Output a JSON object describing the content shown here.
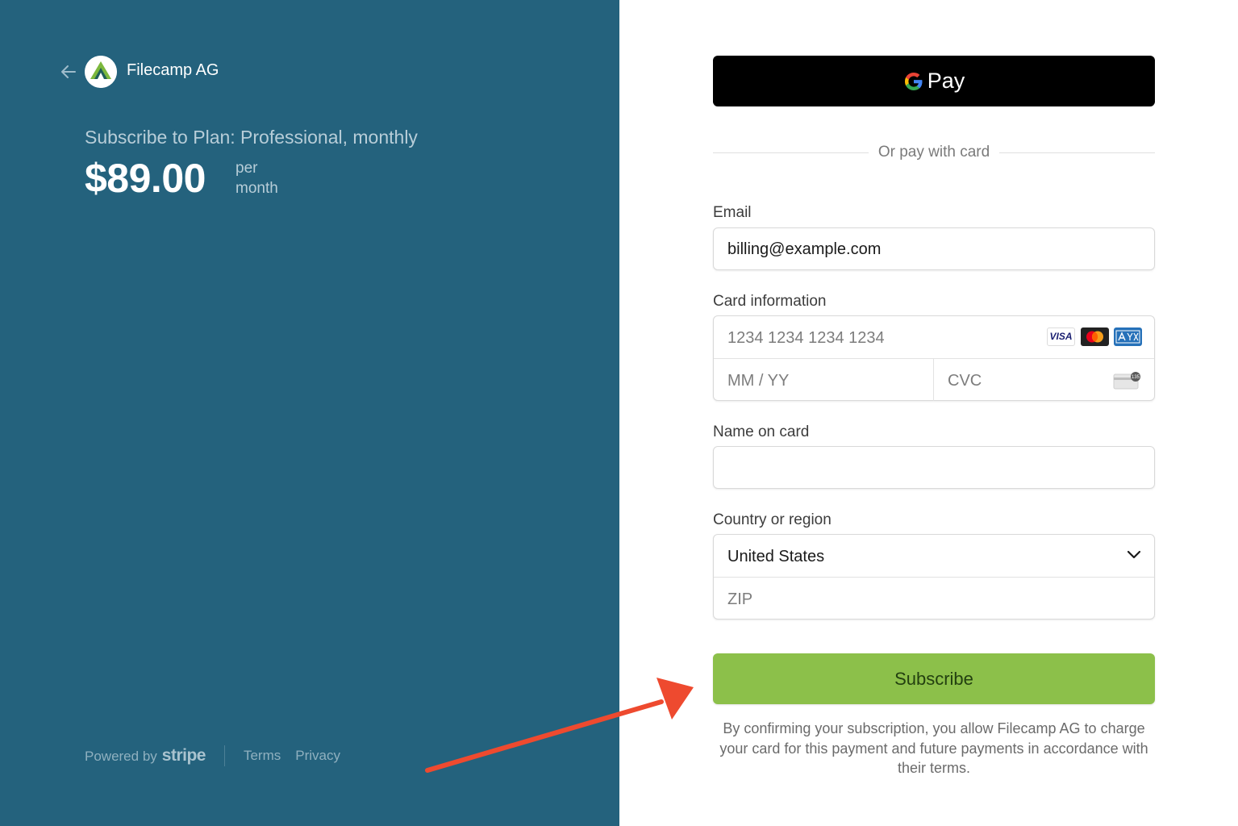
{
  "merchant": {
    "name": "Filecamp AG",
    "logo_icon": "filecamp-logo-icon"
  },
  "plan": {
    "title": "Subscribe to Plan: Professional, monthly",
    "price": "$89.00",
    "period_line1": "per",
    "period_line2": "month"
  },
  "footer": {
    "powered_by": "Powered by",
    "powered_by_brand": "stripe",
    "links": [
      "Terms",
      "Privacy"
    ]
  },
  "payment": {
    "gpay_label": "Pay",
    "or_divider": "Or pay with card",
    "email": {
      "label": "Email",
      "value": "billing@example.com"
    },
    "card": {
      "label": "Card information",
      "number_placeholder": "1234 1234 1234 1234",
      "expiry_placeholder": "MM / YY",
      "cvc_placeholder": "CVC",
      "brands": [
        "VISA",
        "mastercard-icon",
        "amex-icon"
      ],
      "cvc_hint": "135"
    },
    "name": {
      "label": "Name on card",
      "value": ""
    },
    "country": {
      "label": "Country or region",
      "selected": "United States",
      "zip_placeholder": "ZIP"
    },
    "subscribe_label": "Subscribe",
    "terms": "By confirming your subscription, you allow Filecamp AG to charge your card for this payment and future payments in accordance with their terms."
  },
  "colors": {
    "left_panel": "#24627d",
    "subscribe_button": "#8cc04a",
    "annotation_arrow": "#ee4a2f"
  }
}
